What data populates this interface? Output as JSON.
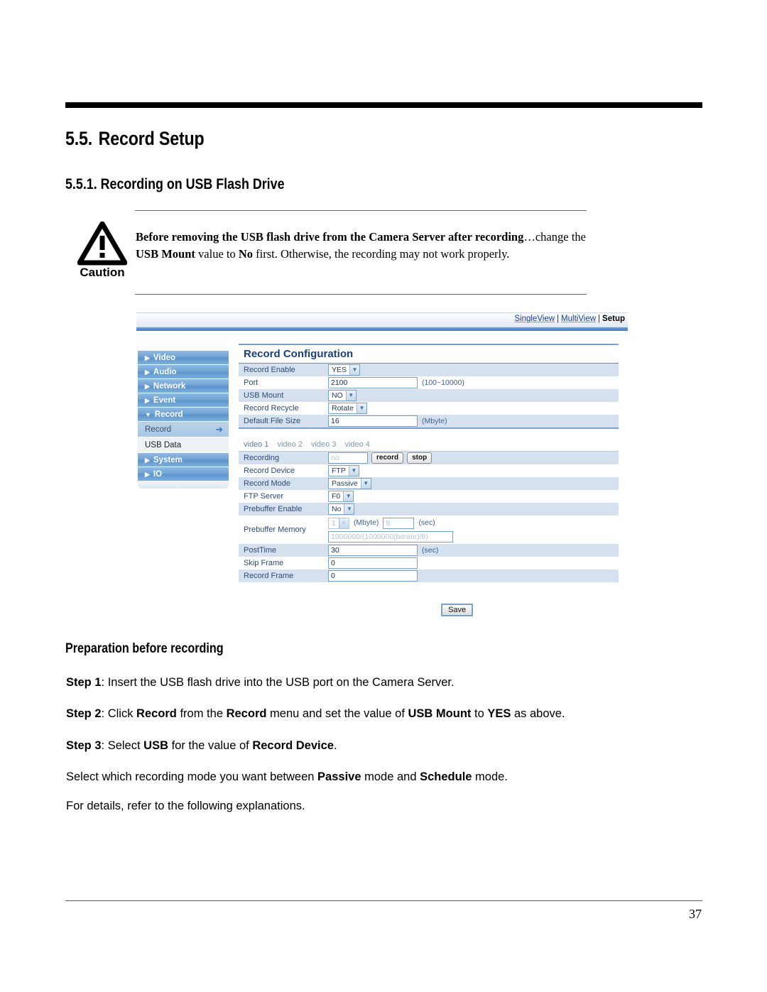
{
  "document": {
    "section_number": "5.5.",
    "section_title": "Record Setup",
    "subsection_number": "5.5.1.",
    "subsection_title": "Recording on USB Flash Drive",
    "page_number": "37"
  },
  "caution": {
    "label": "Caution",
    "icon": "warning-triangle-icon",
    "text_before_1": "Before removing the USB flash drive from the Camera Server after recording",
    "text_ellipsis": "…",
    "text_mid": "change the ",
    "bold_term": "USB Mount",
    "text_after": " value to ",
    "bold_no": "No",
    "text_tail": " first. Otherwise, the recording may not work properly."
  },
  "app": {
    "topbar": {
      "single_view": "SingleView",
      "multi_view": "MultiView",
      "setup": "Setup",
      "separator": "|"
    },
    "sidebar": {
      "items": [
        {
          "label": "Video",
          "marker": "▶",
          "type": "group"
        },
        {
          "label": "Audio",
          "marker": "▶",
          "type": "group"
        },
        {
          "label": "Network",
          "marker": "▶",
          "type": "group"
        },
        {
          "label": "Event",
          "marker": "▶",
          "type": "group"
        },
        {
          "label": "Record",
          "marker": "▼",
          "type": "group-open"
        },
        {
          "label": "Record",
          "marker": "",
          "type": "sub-active",
          "arrow": "➜"
        },
        {
          "label": "USB Data",
          "marker": "",
          "type": "sub"
        },
        {
          "label": "System",
          "marker": "▶",
          "type": "group"
        },
        {
          "label": "IO",
          "marker": "▶",
          "type": "group"
        }
      ]
    },
    "panel_title": "Record Configuration",
    "config_rows": [
      {
        "label": "Record Enable",
        "control": "select",
        "value": "YES",
        "hint": ""
      },
      {
        "label": "Port",
        "control": "text",
        "value": "2100",
        "hint": "(100~10000)"
      },
      {
        "label": "USB Mount",
        "control": "select",
        "value": "NO",
        "hint": ""
      },
      {
        "label": "Record Recycle",
        "control": "select",
        "value": "Rotate",
        "hint": ""
      },
      {
        "label": "Default File Size",
        "control": "text",
        "value": "16",
        "hint": "(Mbyte)"
      }
    ],
    "video_tabs": [
      {
        "label": "video 1",
        "active": true
      },
      {
        "label": "video 2",
        "active": false
      },
      {
        "label": "video 3",
        "active": false
      },
      {
        "label": "video 4",
        "active": false
      }
    ],
    "video_rows": {
      "recording": {
        "label": "Recording",
        "value": "no",
        "record_button": "record",
        "stop_button": "stop"
      },
      "record_device": {
        "label": "Record Device",
        "value": "FTP"
      },
      "record_mode": {
        "label": "Record Mode",
        "value": "Passive"
      },
      "ftp_server": {
        "label": "FTP Server",
        "value": "F0"
      },
      "prebuffer_enable": {
        "label": "Prebuffer Enable",
        "value": "No"
      },
      "prebuffer_memory": {
        "label": "Prebuffer Memory",
        "mbyte_value": "1",
        "mbyte_unit": "(Mbyte)",
        "sec_value": "8",
        "sec_unit": "(sec)",
        "formula": "1000000/(1000000(bitrate)/8)"
      },
      "posttime": {
        "label": "PostTime",
        "value": "30",
        "hint": "(sec)"
      },
      "skip_frame": {
        "label": "Skip Frame",
        "value": "0",
        "hint": ""
      },
      "record_frame": {
        "label": "Record Frame",
        "value": "0",
        "hint": ""
      }
    },
    "save_button": "Save"
  },
  "body": {
    "prep_heading": "Preparation before recording",
    "step1_label": "Step 1",
    "step1_text": ": Insert the USB flash drive into the USB port on the Camera Server.",
    "step2_label": "Step 2",
    "step2_a": ": Click ",
    "step2_b1": "Record",
    "step2_c": " from the ",
    "step2_b2": "Record",
    "step2_d": " menu and set the value of ",
    "step2_b3": "USB Mount",
    "step2_e": " to ",
    "step2_b4": "YES",
    "step2_f": " as above.",
    "step3_label": "Step 3",
    "step3_a": ": Select ",
    "step3_b1": "USB",
    "step3_c": " for the value of ",
    "step3_b2": "Record Device",
    "step3_d": ".",
    "para4_a": "Select which recording mode you want between ",
    "para4_b1": "Passive",
    "para4_c": " mode and ",
    "para4_b2": "Schedule",
    "para4_d": " mode.",
    "para5": "For details, refer to the following explanations."
  },
  "colors": {
    "heading": "#000000",
    "panel_title": "#1c3f7a",
    "sidebar_blue": "#6fa2d4",
    "table_alt": "#d6e1f0",
    "rule": "#7ba0cf"
  }
}
